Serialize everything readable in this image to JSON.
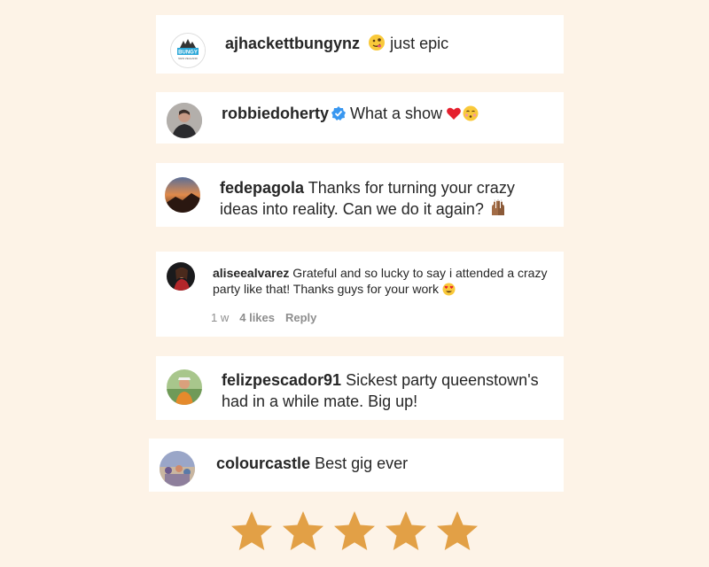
{
  "comments": [
    {
      "username": "ajhackettbungynz",
      "text": "just epic",
      "logo_text": "BUNGY",
      "logo_sub": "NEW ZEALAND"
    },
    {
      "username": "robbiedoherty",
      "text": "What a show"
    },
    {
      "username": "fedepagola",
      "text_line1": "Thanks for turning your crazy",
      "text_line2": "ideas into reality. Can we do it again?"
    },
    {
      "username": "aliseealvarez",
      "text_line1": "Grateful and so lucky to say i attended a crazy",
      "text_line2": "party like that! Thanks guys for your work",
      "time": "1 w",
      "likes": "4 likes",
      "reply": "Reply"
    },
    {
      "username": "felizpescador91",
      "text_line1": "Sickest party queenstown's",
      "text_line2": "had in a while mate. Big up!"
    },
    {
      "username": "colourcastle",
      "text": "Best gig ever"
    }
  ],
  "rating": {
    "stars": 5,
    "max": 5,
    "color": "#e2a046"
  },
  "colors": {
    "background": "#fdf3e7",
    "card": "#ffffff",
    "verified": "#3897f0"
  }
}
